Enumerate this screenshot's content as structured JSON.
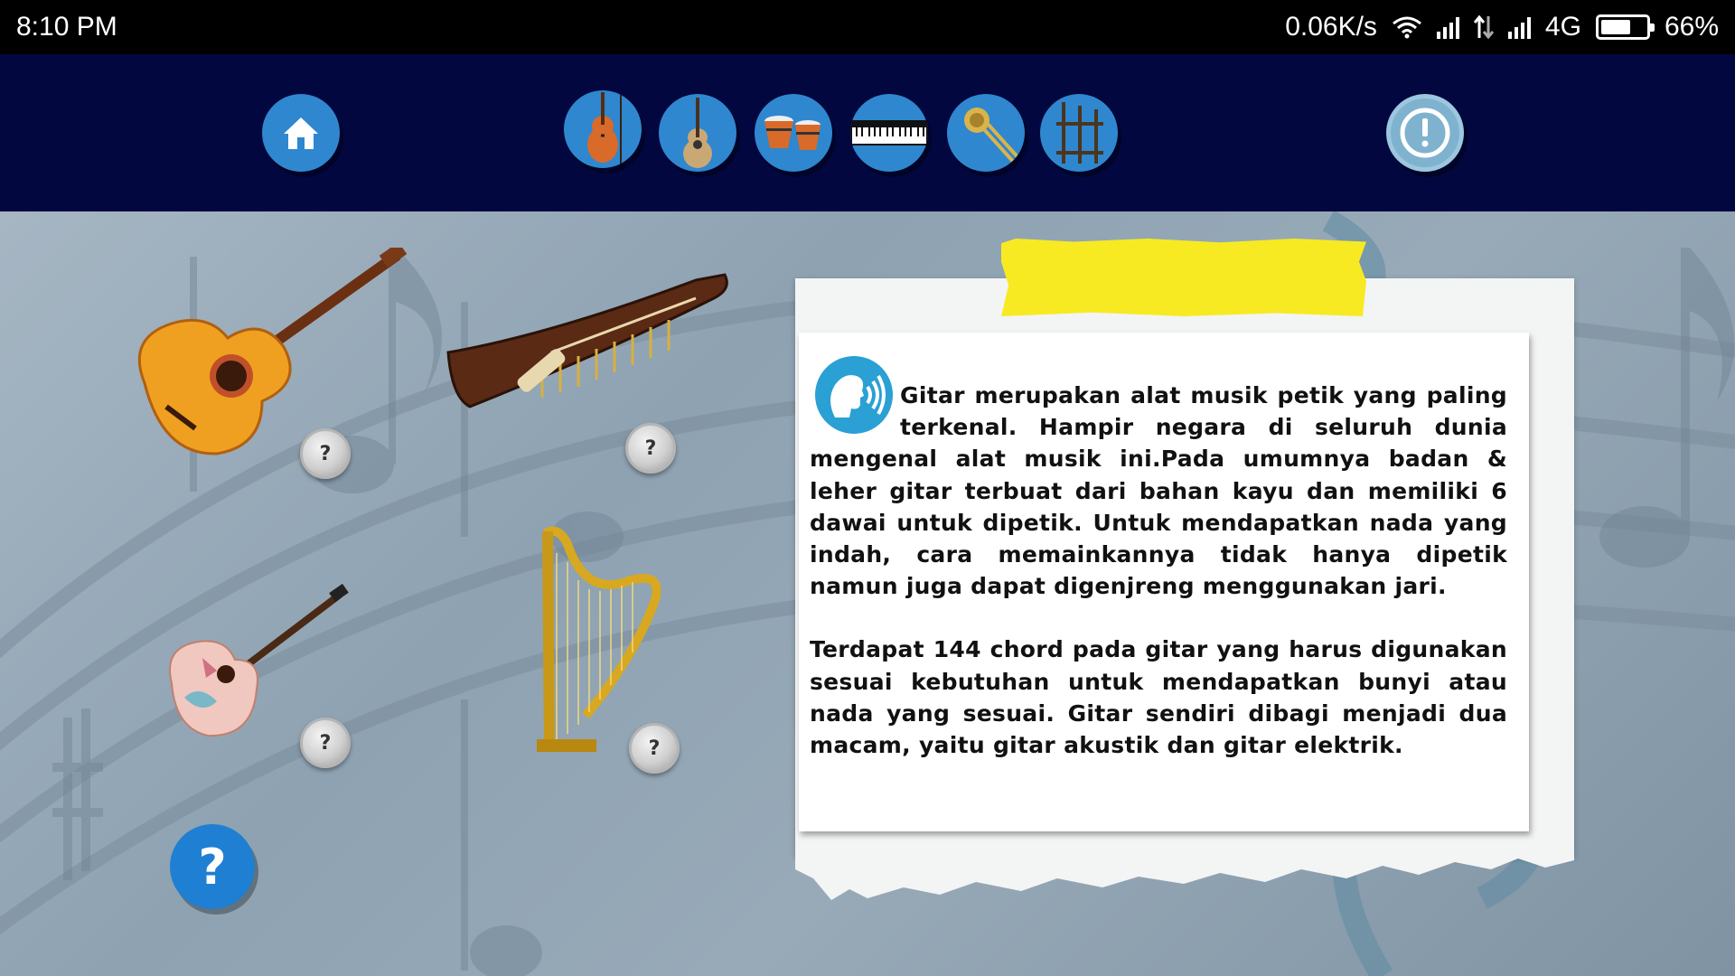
{
  "status_bar": {
    "time": "8:10 PM",
    "network_speed": "0.06K/s",
    "network_type": "4G",
    "battery": "66%",
    "battery_level": 0.66
  },
  "nav": {
    "home_icon": "home-icon",
    "instrument_tabs": [
      {
        "icon": "violin-icon"
      },
      {
        "icon": "guitar-icon"
      },
      {
        "icon": "bongo-drums-icon"
      },
      {
        "icon": "keyboard-icon"
      },
      {
        "icon": "trombone-icon"
      },
      {
        "icon": "angklung-icon"
      }
    ],
    "info_icon": "info-icon"
  },
  "instruments": [
    {
      "name": "guitar",
      "button_label": "?"
    },
    {
      "name": "kecapi",
      "button_label": "?"
    },
    {
      "name": "ukulele",
      "button_label": "?"
    },
    {
      "name": "harp",
      "button_label": "?"
    }
  ],
  "help_button": "?",
  "info_card": {
    "speaker_icon": "speaker-icon",
    "paragraph_1": "Gitar merupakan alat musik petik yang paling terkenal. Hampir negara di seluruh dunia mengenal alat musik ini.Pada umumnya badan & leher gitar terbuat dari bahan kayu dan memiliki 6 dawai untuk dipetik. Untuk mendapatkan nada yang indah, cara memainkannya tidak hanya dipetik namun juga dapat digenjreng menggunakan jari.",
    "paragraph_2": "Terdapat 144 chord pada gitar yang harus digunakan sesuai kebutuhan untuk mendapatkan bunyi atau nada yang sesuai. Gitar sendiri dibagi menjadi dua macam, yaitu gitar akustik dan gitar elektrik."
  },
  "colors": {
    "nav_background": "#03073f",
    "button_blue": "#2f87cf",
    "tape_yellow": "#f7ea22"
  }
}
